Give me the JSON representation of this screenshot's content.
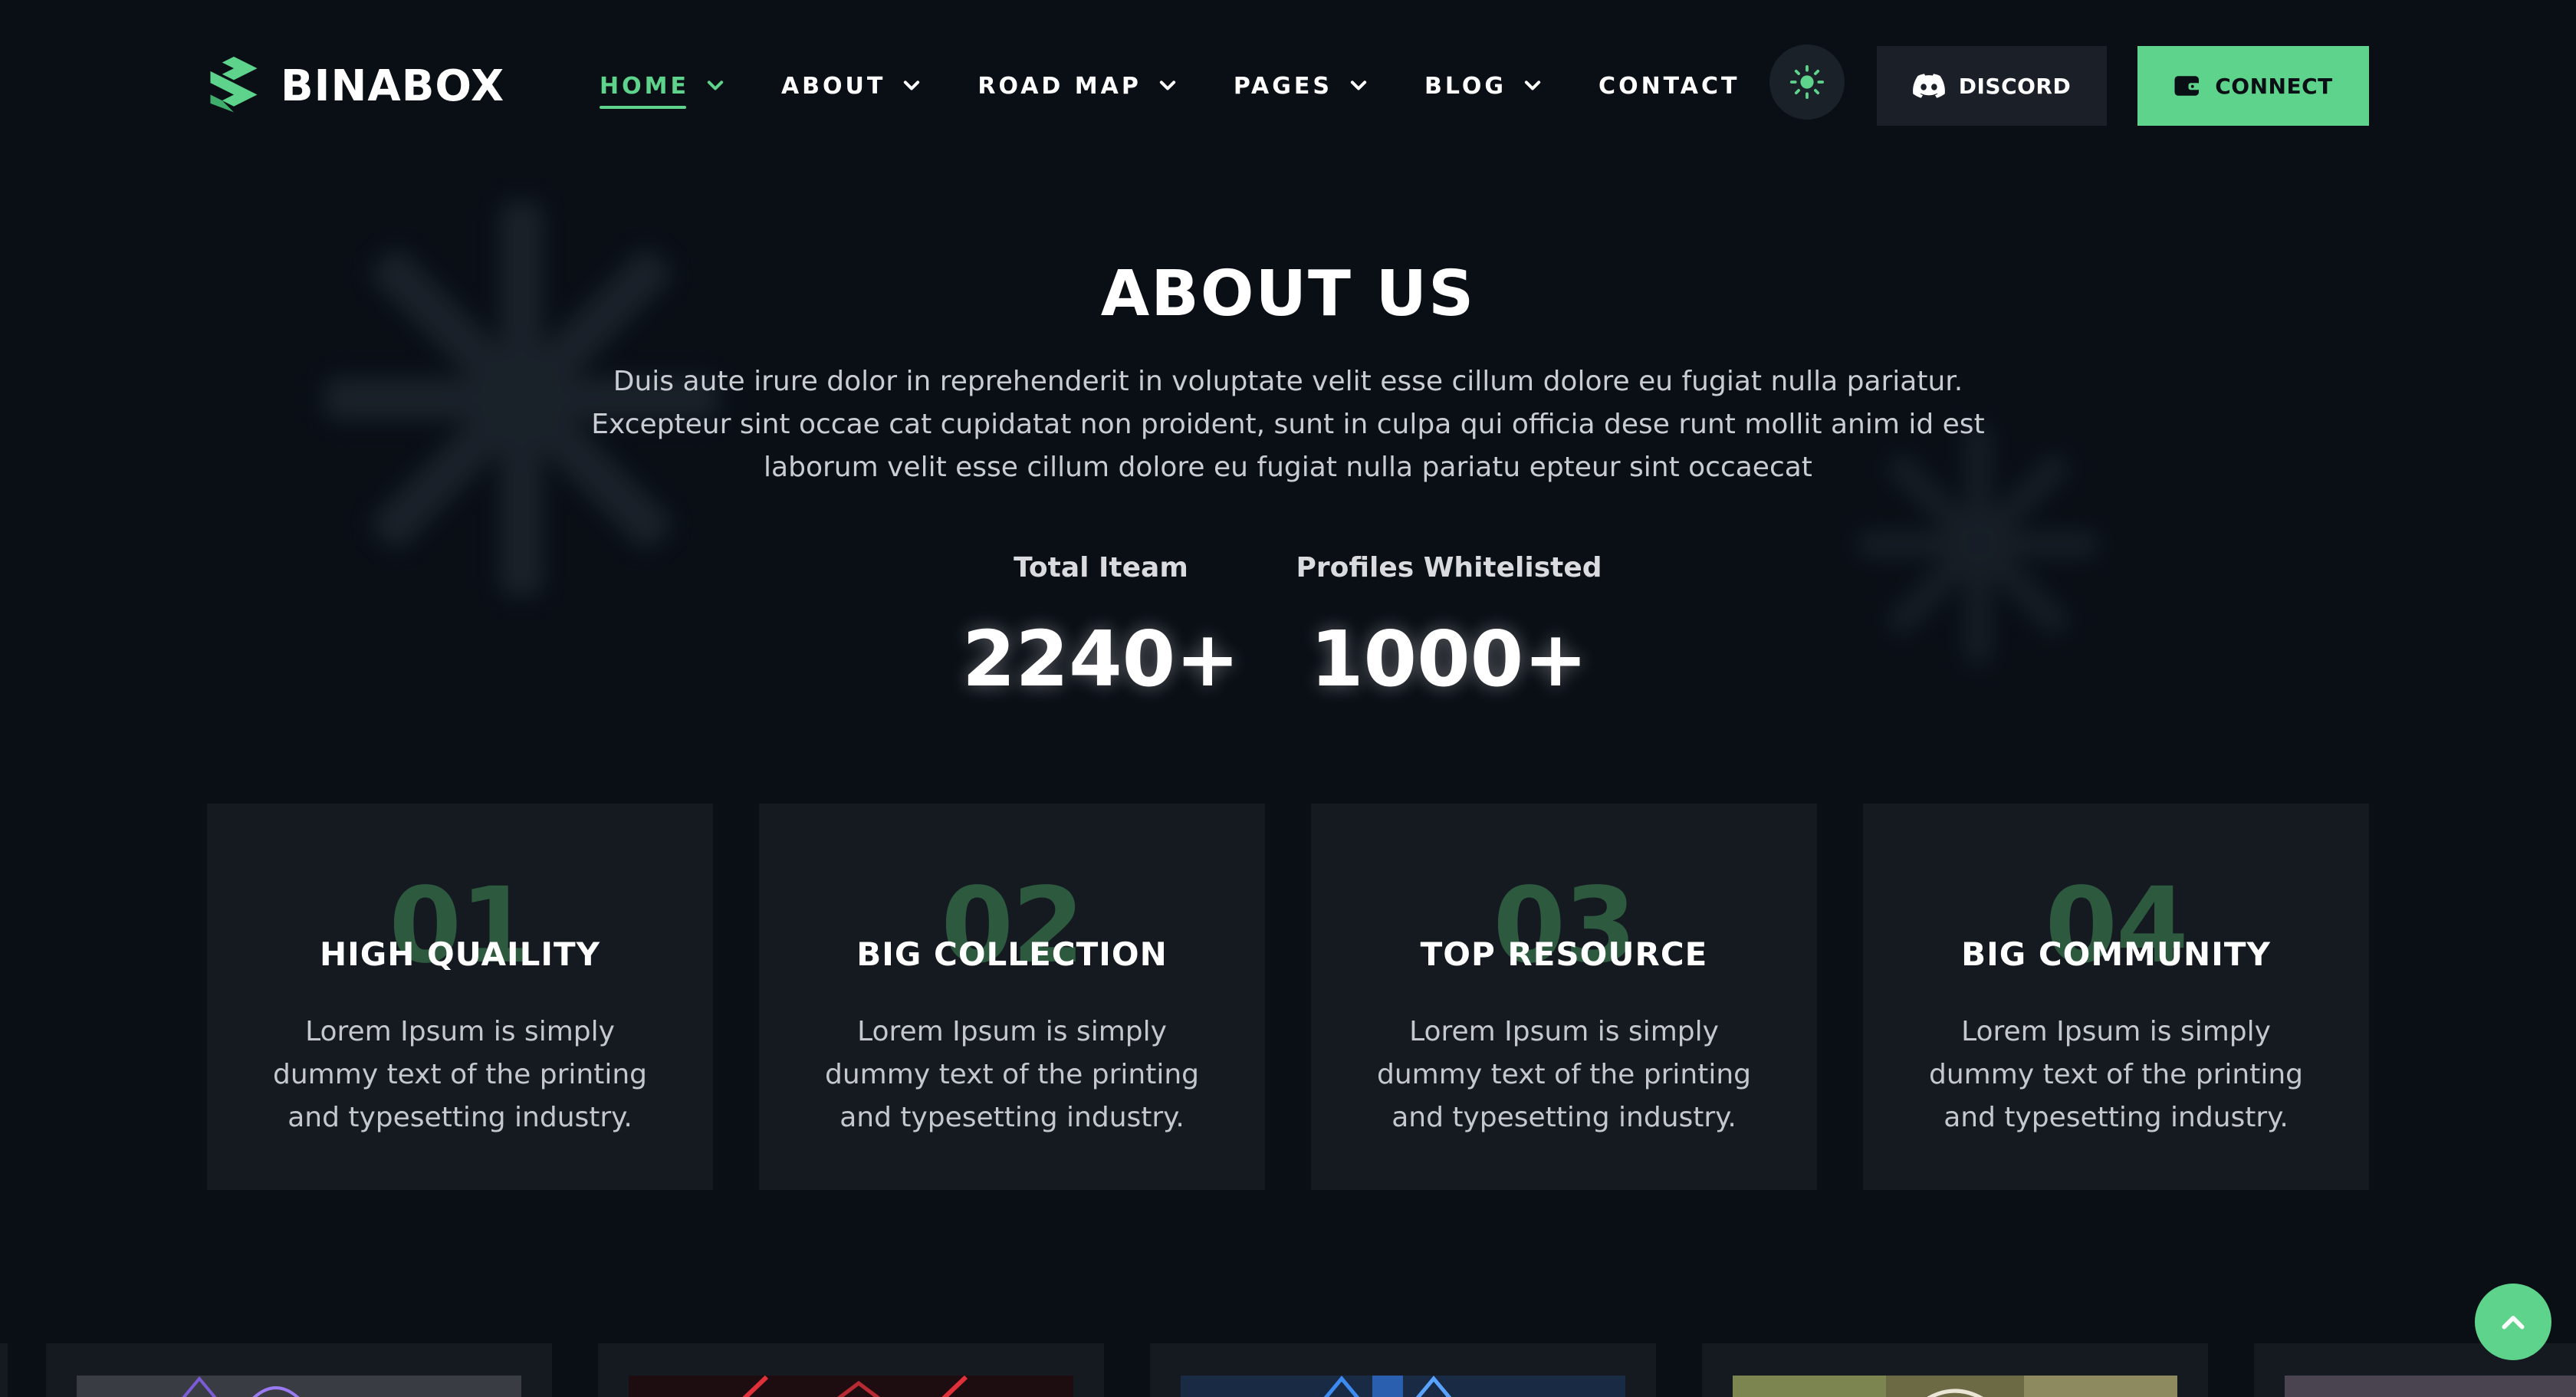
{
  "brand": {
    "name": "BINABOX",
    "accent": "#5ed38b",
    "background": "#0a0f16",
    "card_bg": "#151a21"
  },
  "nav": {
    "items": [
      {
        "label": "HOME",
        "active": true,
        "dropdown": true
      },
      {
        "label": "ABOUT",
        "active": false,
        "dropdown": true
      },
      {
        "label": "ROAD MAP",
        "active": false,
        "dropdown": true
      },
      {
        "label": "PAGES",
        "active": false,
        "dropdown": true
      },
      {
        "label": "BLOG",
        "active": false,
        "dropdown": true
      },
      {
        "label": "CONTACT",
        "active": false,
        "dropdown": false
      }
    ]
  },
  "header_actions": {
    "theme_toggle_icon": "sun-icon",
    "discord_label": "DISCORD",
    "discord_icon": "discord-icon",
    "connect_label": "CONNECT",
    "connect_icon": "wallet-icon"
  },
  "about": {
    "title": "ABOUT US",
    "lines": [
      "Duis aute irure dolor in reprehenderit in voluptate velit esse cillum dolore eu fugiat nulla pariatur.",
      "Excepteur sint occae cat cupidatat non proident, sunt in culpa qui officia dese runt mollit anim id est",
      "laborum velit esse cillum dolore eu fugiat nulla pariatu epteur sint occaecat"
    ],
    "stats": [
      {
        "label": "Total Iteam",
        "value": "2240+"
      },
      {
        "label": "Profiles Whitelisted",
        "value": "1000+"
      }
    ]
  },
  "features": [
    {
      "number": "01",
      "title": "HIGH QUAILITY",
      "lines": [
        "Lorem Ipsum is simply",
        "dummy text of the printing",
        "and typesetting industry."
      ]
    },
    {
      "number": "02",
      "title": "BIG COLLECTION",
      "lines": [
        "Lorem Ipsum is simply",
        "dummy text of the printing",
        "and typesetting industry."
      ]
    },
    {
      "number": "03",
      "title": "TOP RESOURCE",
      "lines": [
        "Lorem Ipsum is simply",
        "dummy text of the printing",
        "and typesetting industry."
      ]
    },
    {
      "number": "04",
      "title": "BIG COMMUNITY",
      "lines": [
        "Lorem Ipsum is simply",
        "dummy text of the printing",
        "and typesetting industry."
      ]
    }
  ],
  "scroll_top_icon": "chevron-up-icon"
}
